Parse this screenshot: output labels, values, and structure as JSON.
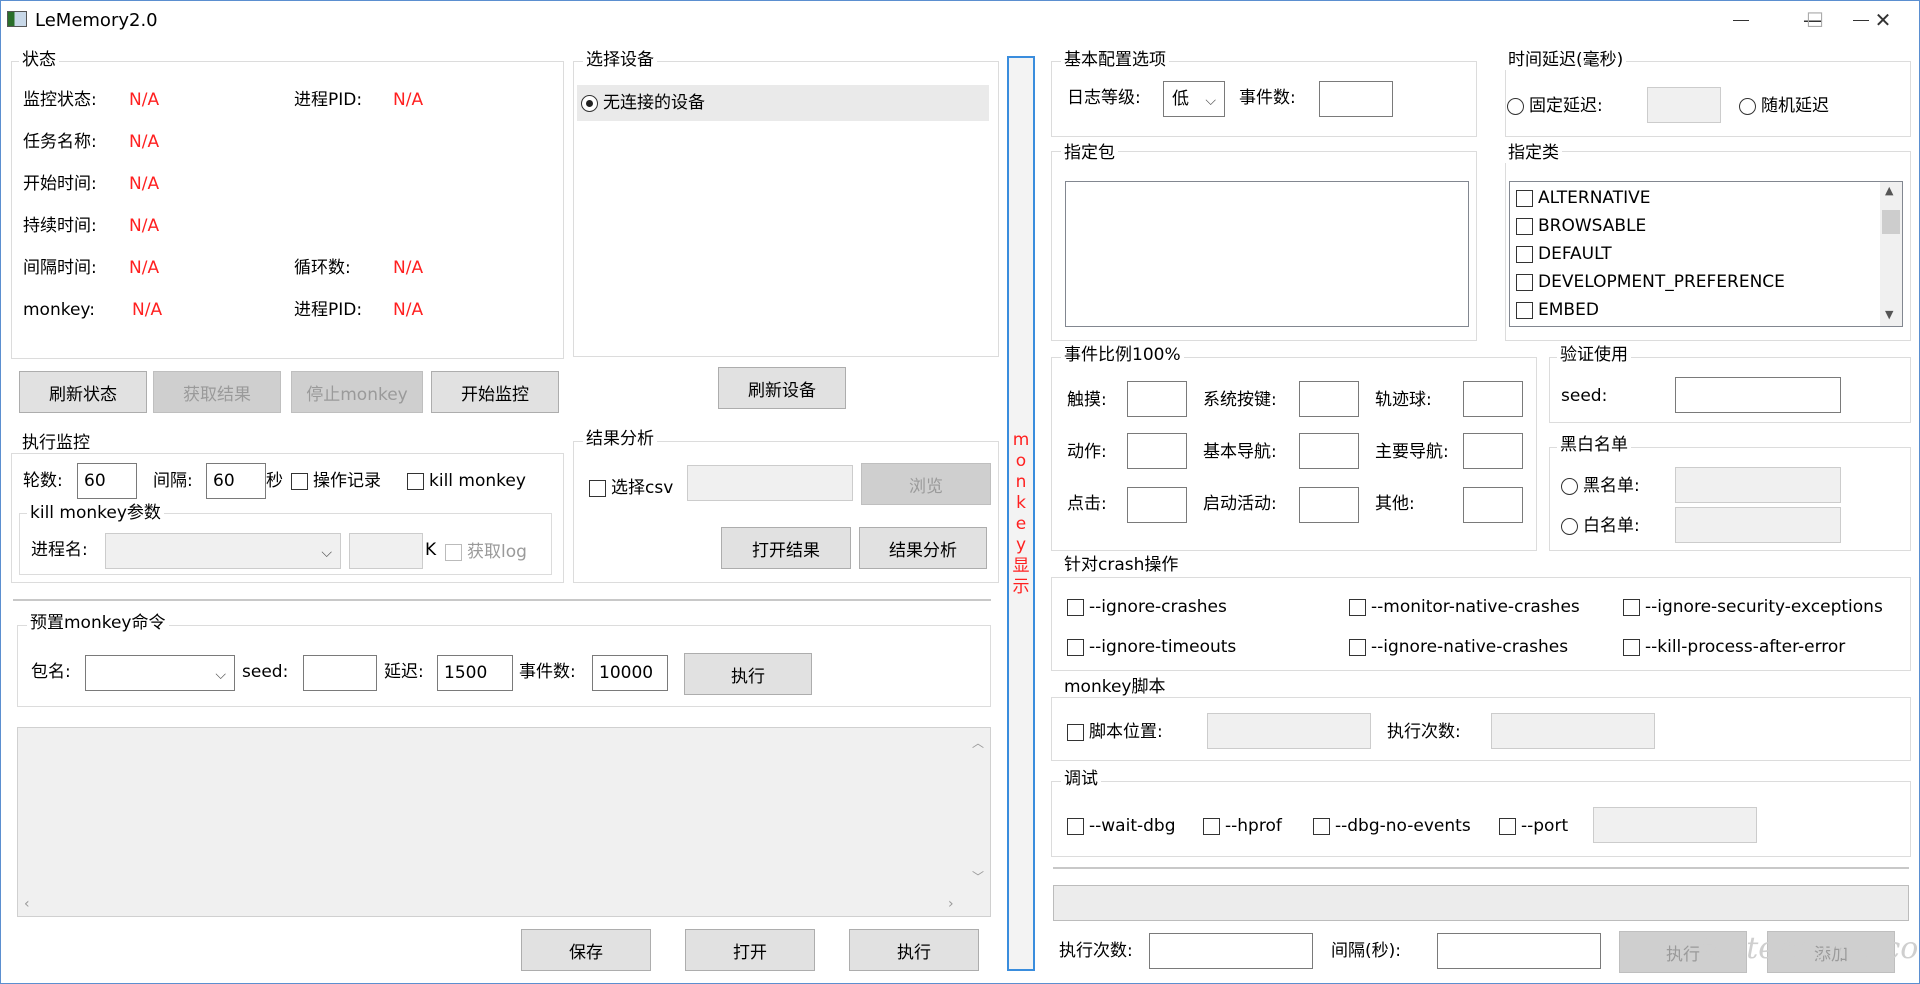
{
  "window": {
    "title": "LeMemory2.0",
    "close_glyph": "✕",
    "max_glyph": "☐",
    "min_glyph": "—"
  },
  "status": {
    "title": "状态",
    "rows": [
      {
        "label": "监控状态:",
        "value": "N/A"
      },
      {
        "label": "任务名称:",
        "value": "N/A"
      },
      {
        "label": "开始时间:",
        "value": "N/A"
      },
      {
        "label": "持续时间:",
        "value": "N/A"
      },
      {
        "label": "间隔时间:",
        "value": "N/A"
      },
      {
        "label": "monkey:",
        "value": "N/A"
      }
    ],
    "right_rows": [
      {
        "label": "进程PID:",
        "value": "N/A"
      },
      {
        "label": "循环数:",
        "value": "N/A"
      },
      {
        "label": "进程PID:",
        "value": "N/A"
      }
    ],
    "buttons": {
      "refresh": "刷新状态",
      "get_result": "获取结果",
      "stop_monkey": "停止monkey",
      "start_monitor": "开始监控"
    }
  },
  "device": {
    "title": "选择设备",
    "option": "无连接的设备",
    "refresh": "刷新设备"
  },
  "exec_monitor": {
    "title": "执行监控",
    "rounds_label": "轮数:",
    "rounds": "60",
    "interval_label": "间隔:",
    "interval": "60",
    "unit": "秒",
    "op_record": "操作记录",
    "kill_monkey": "kill monkey",
    "kill_params_title": "kill monkey参数",
    "proc_label": "进程名:",
    "k_label": "K",
    "get_log": "获取log"
  },
  "analysis": {
    "title": "结果分析",
    "csv": "选择csv",
    "browse": "浏览",
    "open": "打开结果",
    "analyze": "结果分析"
  },
  "preset": {
    "title": "预置monkey命令",
    "pkg_label": "包名:",
    "seed_label": "seed:",
    "delay_label": "延迟:",
    "delay": "1500",
    "events_label": "事件数:",
    "events": "10000",
    "exec": "执行"
  },
  "bottom_left": {
    "save": "保存",
    "open": "打开",
    "exec": "执行"
  },
  "side_bar": {
    "chars": [
      "m",
      "o",
      "n",
      "k",
      "e",
      "y",
      "显",
      "示"
    ]
  },
  "basic": {
    "title": "基本配置选项",
    "log_label": "日志等级:",
    "log_value": "低",
    "events_label": "事件数:"
  },
  "delay": {
    "title": "时间延迟(毫秒)",
    "fixed": "固定延迟:",
    "random": "随机延迟"
  },
  "pkg": {
    "title": "指定包"
  },
  "cls": {
    "title": "指定类",
    "items": [
      "ALTERNATIVE",
      "BROWSABLE",
      "DEFAULT",
      "DEVELOPMENT_PREFERENCE",
      "EMBED"
    ]
  },
  "ratio": {
    "title": "事件比例100%",
    "labels": [
      "触摸:",
      "系统按键:",
      "轨迹球:",
      "动作:",
      "基本导航:",
      "主要导航:",
      "点击:",
      "启动活动:",
      "其他:"
    ]
  },
  "verify": {
    "title": "验证使用",
    "seed_label": "seed:"
  },
  "bwlist": {
    "title": "黑白名单",
    "black": "黑名单:",
    "white": "白名单:"
  },
  "crash": {
    "title": "针对crash操作",
    "opts": [
      "--ignore-crashes",
      "--monitor-native-crashes",
      "--ignore-security-exceptions",
      "--ignore-timeouts",
      "--ignore-native-crashes",
      "--kill-process-after-error"
    ]
  },
  "script": {
    "title": "monkey脚本",
    "loc": "脚本位置:",
    "times": "执行次数:"
  },
  "debug": {
    "title": "调试",
    "opts": [
      "--wait-dbg",
      "--hprof",
      "--dbg-no-events",
      "--port"
    ]
  },
  "bottom_right": {
    "times_label": "执行次数:",
    "interval_label": "间隔(秒):",
    "exec": "执行",
    "add": "添加"
  },
  "watermark": "testerhome.com"
}
